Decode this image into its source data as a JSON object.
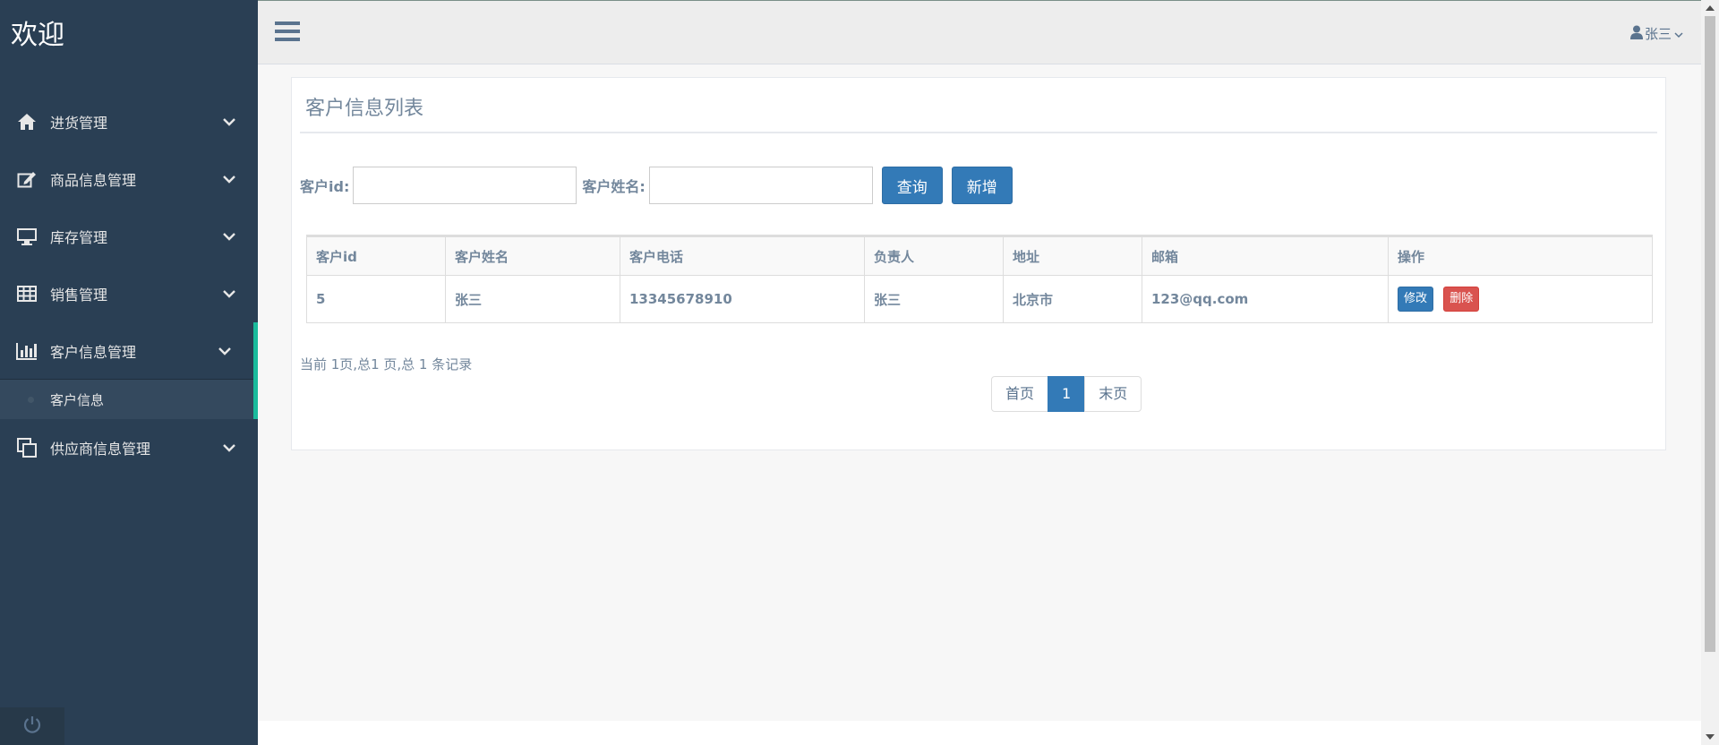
{
  "sidebar": {
    "brand": "欢迎",
    "items": [
      {
        "label": "进货管理",
        "icon": "home-icon"
      },
      {
        "label": "商品信息管理",
        "icon": "edit-icon"
      },
      {
        "label": "库存管理",
        "icon": "desktop-icon"
      },
      {
        "label": "销售管理",
        "icon": "table-icon"
      },
      {
        "label": "客户信息管理",
        "icon": "bar-chart-icon"
      },
      {
        "label": "供应商信息管理",
        "icon": "clone-icon"
      }
    ],
    "active_index": 4,
    "submenu": [
      {
        "label": "客户信息"
      }
    ]
  },
  "header": {
    "user_name": "张三"
  },
  "panel": {
    "title": "客户信息列表",
    "search": {
      "id_label": "客户id:",
      "id_value": "",
      "name_label": "客户姓名:",
      "name_value": "",
      "query_label": "查询",
      "add_label": "新增"
    },
    "table": {
      "headers": [
        "客户id",
        "客户姓名",
        "客户电话",
        "负责人",
        "地址",
        "邮箱",
        "操作"
      ],
      "rows": [
        {
          "id": "5",
          "name": "张三",
          "phone": "13345678910",
          "manager": "张三",
          "address": "北京市",
          "email": "123@qq.com",
          "edit_label": "修改",
          "delete_label": "删除"
        }
      ]
    },
    "record_info": "当前 1页,总1 页,总 1 条记录",
    "pagination": {
      "first": "首页",
      "current": "1",
      "last": "末页"
    }
  },
  "colors": {
    "sidebar_bg": "#2a3f54",
    "accent": "#1abb9c",
    "primary": "#337ab7",
    "danger": "#d9534f",
    "text_muted": "#73879c"
  }
}
